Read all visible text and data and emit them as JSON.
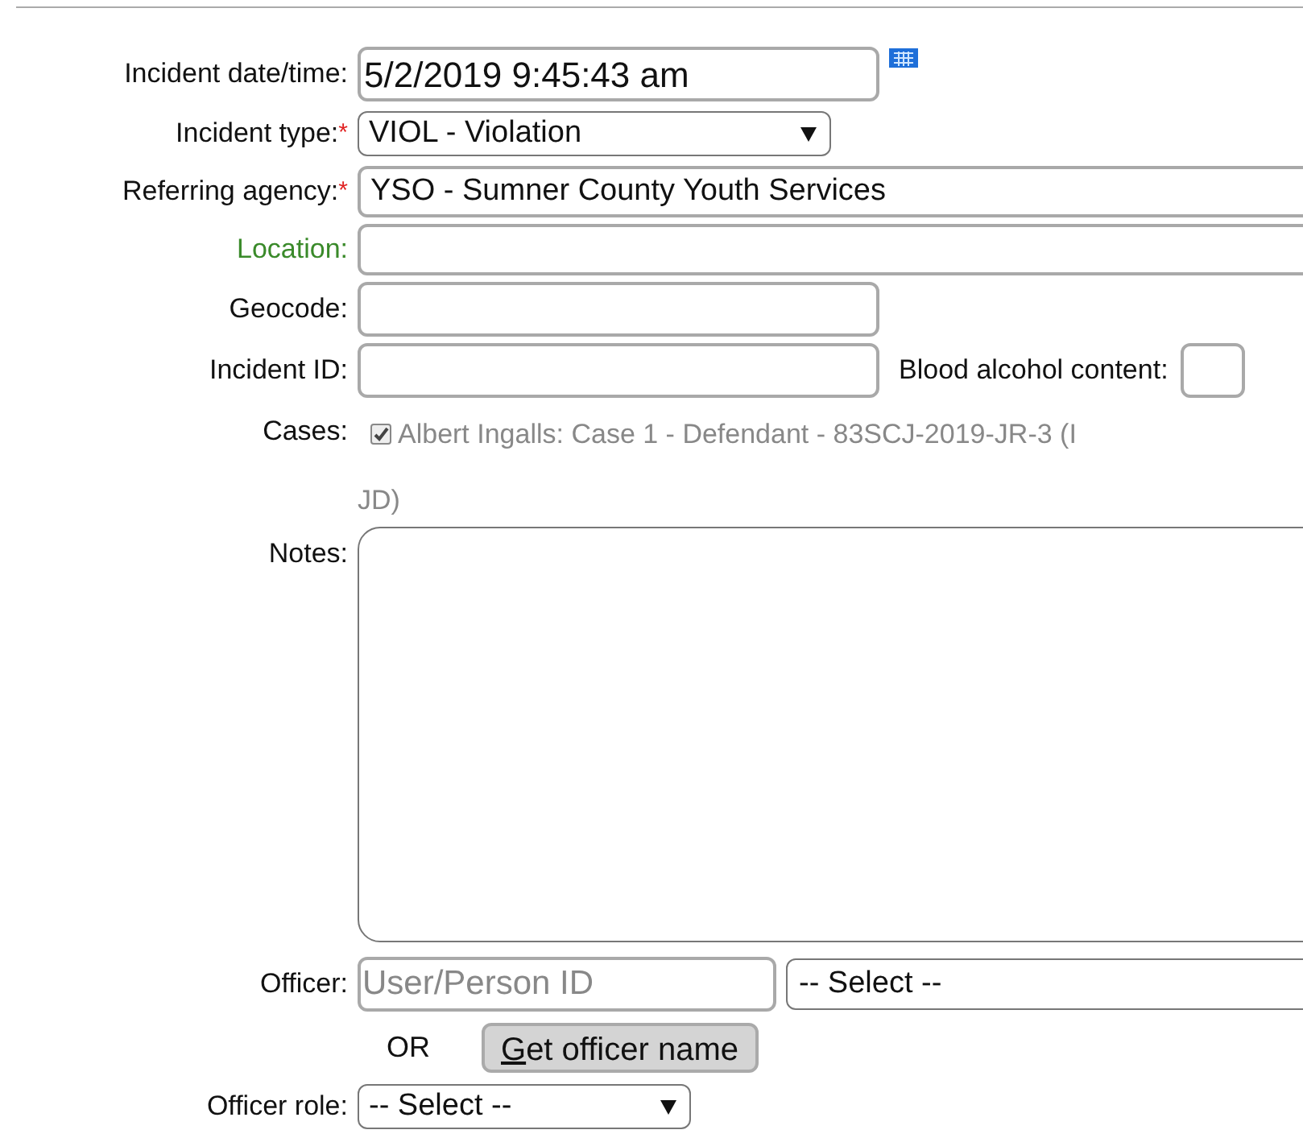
{
  "fields": [
    {
      "kind": "text",
      "label": "Incident date/time:",
      "value": "5/2/2019 9:45:43 am",
      "calendar": true
    },
    {
      "kind": "select",
      "label": "Incident type:",
      "required_mark": "*",
      "value": "VIOL - Violation"
    },
    {
      "kind": "wide",
      "label": "Referring agency:",
      "required_mark": "*",
      "value": "YSO - Sumner County Youth Services"
    },
    {
      "kind": "wide",
      "label": "Location:",
      "highlight": true
    },
    {
      "kind": "text",
      "label": "Geocode:"
    },
    {
      "kind": "text",
      "label": "Incident ID:",
      "side_label": "Blood alcohol content:"
    },
    {
      "kind": "cases",
      "label": "Cases:",
      "checked": true,
      "lines": [
        "Albert Ingalls: Case 1 - Defendant - 83SCJ-2019-JR-3 (I",
        "JD)"
      ]
    },
    {
      "kind": "notes",
      "label": "Notes:"
    },
    {
      "kind": "officer",
      "label": "Officer:",
      "placeholder": "User/Person ID",
      "select": "-- Select --",
      "or": "OR",
      "button_key": "G",
      "button_rest": "et officer name"
    },
    {
      "kind": "select",
      "label": "Officer role:",
      "value": "-- Select --",
      "short": true
    }
  ]
}
